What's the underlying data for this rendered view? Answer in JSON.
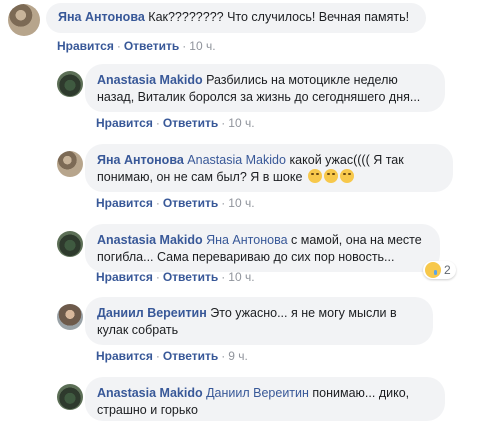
{
  "common": {
    "like_label": "Нравится",
    "reply_label": "Ответить",
    "separator": "·"
  },
  "comments": [
    {
      "author": "Яна Антонова",
      "mention": "",
      "text": "Как???????? Что случилось! Вечная память!",
      "time": "10 ч."
    },
    {
      "author": "Anastasia Makido",
      "mention": "",
      "text": "Разбились на мотоцикле неделю назад, Виталик боролся за жизнь до сегодняшего дня...",
      "time": "10 ч."
    },
    {
      "author": "Яна Антонова",
      "mention": "Anastasia Makido",
      "text": "какой ужас(((( Я так понимаю, он не сам был? Я в шоке",
      "time": "10 ч.",
      "emoji_icons": [
        "crying-face-icon",
        "crying-face-icon",
        "crying-face-icon"
      ]
    },
    {
      "author": "Anastasia Makido",
      "mention": "Яна Антонова",
      "text": "с мамой, она на месте погибла... Сама перевариваю до сих пор новость...",
      "time": "10 ч.",
      "reaction": {
        "icon": "sad-face-icon",
        "count": "2"
      }
    },
    {
      "author": "Даниил Вереитин",
      "mention": "",
      "text": "Это ужасно... я не могу мысли в кулак собрать",
      "time": "9 ч."
    },
    {
      "author": "Anastasia Makido",
      "mention": "Даниил Вереитин",
      "text": "понимаю... дико, страшно и горько",
      "time": ""
    }
  ]
}
